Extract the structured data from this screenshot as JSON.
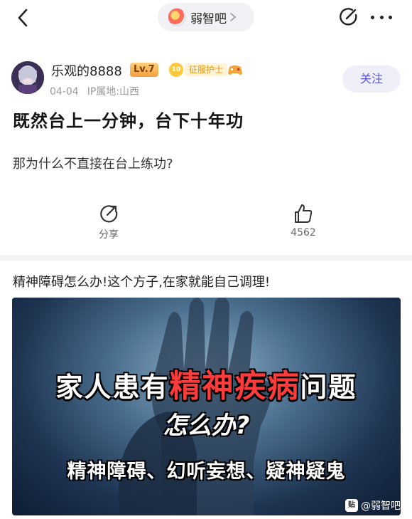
{
  "header": {
    "forum_name": "弱智吧"
  },
  "author": {
    "username": "乐观的8888",
    "level": "Lv.7",
    "title_level": "10",
    "title": "征服护士",
    "date": "04-04",
    "ip": "IP属地:山西",
    "follow_label": "关注"
  },
  "post": {
    "title": "既然台上一分钟，台下十年功",
    "body": "那为什么不直接在台上练功?"
  },
  "actions": {
    "share_label": "分享",
    "like_count": "4562"
  },
  "ad": {
    "title": "精神障碍怎么办!这个方子,在家就能自己调理!",
    "image_line1_part1": "家人患有",
    "image_line1_highlight": "精神疾病",
    "image_line1_part2": "问题",
    "image_line2": "怎么办?",
    "image_line3": "精神障碍、幻听妄想、疑神疑鬼",
    "watermark_icon": "贴",
    "watermark": "@弱智吧"
  },
  "colors": {
    "accent": "#5c56d6",
    "level_badge": "#f4a03c",
    "highlight_red": "#ff3b3b"
  },
  "icons": [
    "back-icon",
    "forum-avatar-icon",
    "chevron-right-icon",
    "edit-icon",
    "more-icon",
    "share-icon",
    "thumbs-up-icon",
    "game-controller-icon"
  ]
}
